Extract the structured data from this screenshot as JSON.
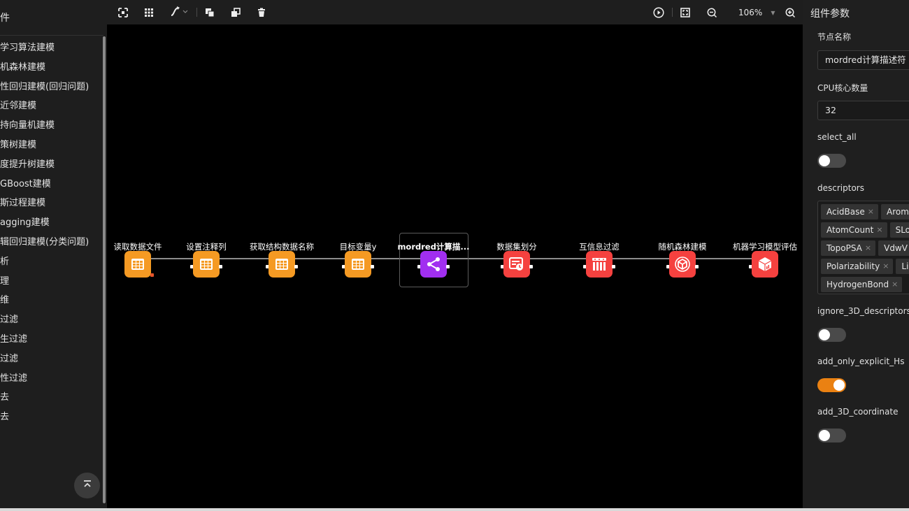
{
  "left_panel": {
    "title": "件",
    "items": [
      "学习算法建模",
      "机森林建模",
      "性回归建模(回归问题)",
      "近邻建模",
      "持向量机建模",
      "策树建模",
      "度提升树建模",
      "GBoost建模",
      "斯过程建模",
      "agging建模",
      "辑回归建模(分类问题)",
      "析",
      "理",
      "维",
      "过滤",
      "生过滤",
      "过滤",
      "性过滤",
      "去",
      "去"
    ]
  },
  "toolbar": {
    "zoom_value": "106%",
    "zoom_caret": "▼"
  },
  "canvas": {
    "nodes": [
      {
        "label": "读取数据文件",
        "color": "#f59a23",
        "icon": "table-grid-icon"
      },
      {
        "label": "设置注释列",
        "color": "#f59a23",
        "icon": "table-grid-icon"
      },
      {
        "label": "获取结构数据名称",
        "color": "#f59a23",
        "icon": "table-grid-icon"
      },
      {
        "label": "目标变量y",
        "color": "#f59a23",
        "icon": "table-grid-icon"
      },
      {
        "label": "mordred计算描...",
        "color": "#a12ff0",
        "icon": "share-nodes-icon"
      },
      {
        "label": "数据集划分",
        "color": "#f5413f",
        "icon": "dataset-split-icon"
      },
      {
        "label": "互信息过滤",
        "color": "#f5413f",
        "icon": "filter-columns-icon"
      },
      {
        "label": "随机森林建模",
        "color": "#f5413f",
        "icon": "cube-network-icon"
      },
      {
        "label": "机器学习模型评估",
        "color": "#f5413f",
        "icon": "cube-chart-icon"
      }
    ]
  },
  "right_panel": {
    "header": "组件参数",
    "node_name_label": "节点名称",
    "node_name_value": "mordred计算描述符",
    "cpu_label": "CPU核心数量",
    "cpu_value": "32",
    "select_all_label": "select_all",
    "select_all_on": false,
    "descriptors_label": "descriptors",
    "descriptors": [
      "AcidBase",
      "Aroma",
      "AtomCount",
      "SLo",
      "TopoPSA",
      "VdwV",
      "Polarizability",
      "Lip",
      "HydrogenBond"
    ],
    "ignore_3d_label": "ignore_3D_descriptors",
    "ignore_3d_on": false,
    "add_hs_label": "add_only_explicit_Hs",
    "add_hs_on": true,
    "add_3d_label": "add_3D_coordinate",
    "add_3d_on": false
  },
  "colors": {
    "accent": "#ea8112",
    "orange_node": "#f59a23",
    "purple_node": "#a12ff0",
    "red_node": "#f5413f"
  }
}
